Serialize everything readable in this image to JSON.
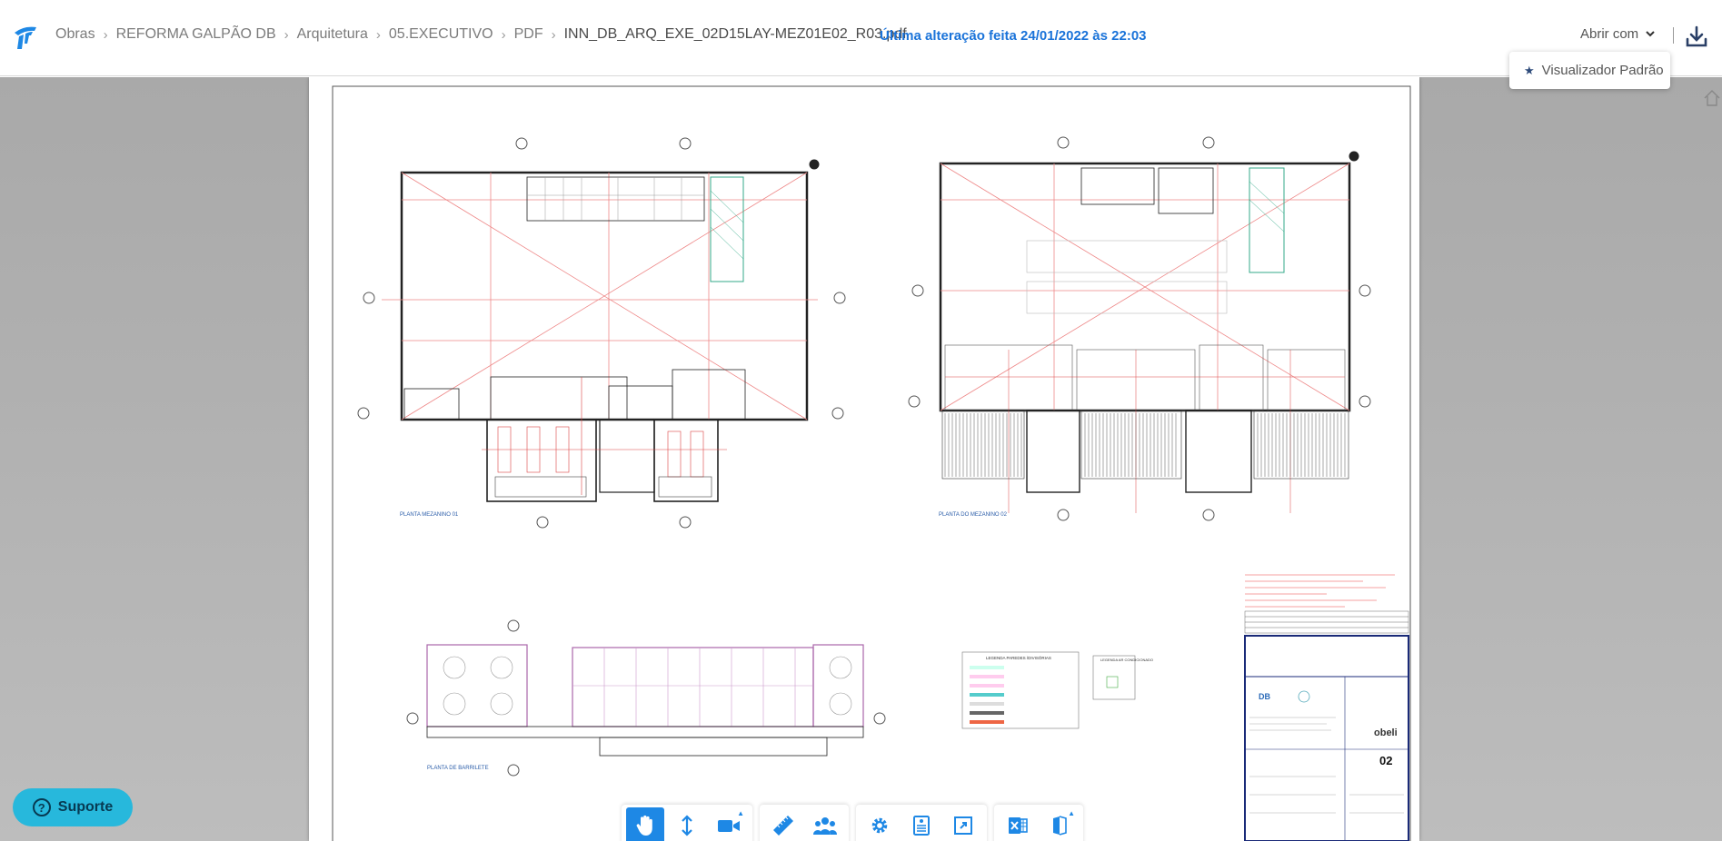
{
  "breadcrumb": [
    "Obras",
    "REFORMA GALPÃO DB",
    "Arquitetura",
    "05.EXECUTIVO",
    "PDF"
  ],
  "file_name": "INN_DB_ARQ_EXE_02D15LAY-MEZ01E02_R03.pdf",
  "last_modified": "Última alteração feita 24/01/2022 às 22:03",
  "open_with_label": "Abrir com",
  "dropdown": {
    "item": "Visualizador Padrão"
  },
  "support_label": "Suporte",
  "drawing": {
    "plan1_label": "PLANTA MEZANINO 01",
    "plan2_label": "PLANTA DO MEZANINO 02",
    "plan3_label": "PLANTA DE BARRILETE",
    "legend_title": "LEGENDA PAREDES /DIVISÓRIAS",
    "legend2_title": "LEGENDA AR CONDICIONADO",
    "title_block_brand": "obeli",
    "sheet_number": "02"
  },
  "colors": {
    "accent": "#1e88e5",
    "link": "#1a73d9",
    "support": "#27b8dc"
  }
}
